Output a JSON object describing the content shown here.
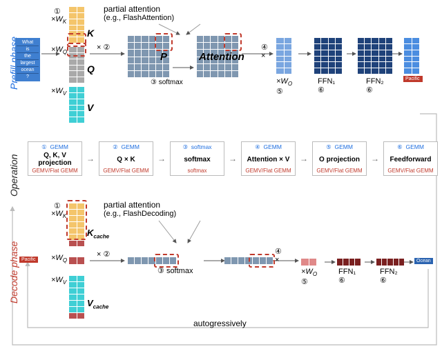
{
  "phases": {
    "prefill": "Prefill phase",
    "operation": "Operation",
    "decode": "Decode phase"
  },
  "input": {
    "tokens": [
      "What",
      "is",
      "the",
      "largest",
      "ocean",
      "?"
    ]
  },
  "output": {
    "prefill_token": "Pacific",
    "decode_token": "Ocean"
  },
  "prefill": {
    "partial_attention": "partial attention",
    "partial_attention_eg": "(e.g., FlashAttention)",
    "wk": "×W_K",
    "wq": "×W_Q",
    "wv": "×W_V",
    "K": "K",
    "Q": "Q",
    "V": "V",
    "softmax": "softmax",
    "P": "P",
    "Attention": "Attention",
    "Wo": "×W_O",
    "FFN1": "FFN₁",
    "FFN2": "FFN₂"
  },
  "decode": {
    "partial_attention": "partial attention",
    "partial_attention_eg": "(e.g., FlashDecoding)",
    "wk": "×W_K",
    "wq": "×W_Q",
    "wv": "×W_V",
    "Kcache": "K_cache",
    "Vcache": "V_cache",
    "softmax": "softmax",
    "Wo": "×W_O",
    "FFN1": "FFN₁",
    "FFN2": "FFN₂",
    "autoregressively": "autogressively"
  },
  "steps": {
    "s1": "①",
    "s2": "②",
    "s3": "③",
    "s4": "④",
    "s5": "⑤",
    "s6": "⑥"
  },
  "ops": [
    {
      "num": "①",
      "top": "GEMM",
      "mid": "Q, K, V projection",
      "bot": "GEMV/Flat GEMM"
    },
    {
      "num": "②",
      "top": "GEMM",
      "mid": "Q × K",
      "bot": "GEMV/Flat GEMM"
    },
    {
      "num": "③",
      "top": "softmax",
      "mid": "softmax",
      "bot": "softmax"
    },
    {
      "num": "④",
      "top": "GEMM",
      "mid": "Attention × V",
      "bot": "GEMV/Flat GEMM"
    },
    {
      "num": "⑤",
      "top": "GEMM",
      "mid": "O projection",
      "bot": "GEMV/Flat GEMM"
    },
    {
      "num": "⑥",
      "top": "GEMM",
      "mid": "Feedforward",
      "bot": "GEMV/Flat GEMM"
    }
  ]
}
